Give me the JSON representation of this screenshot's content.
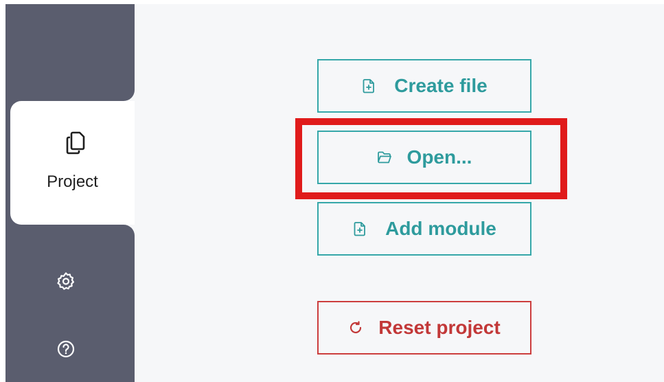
{
  "sidebar": {
    "active_tab": {
      "label": "Project",
      "icon": "copy-files-icon"
    },
    "items": [
      {
        "icon": "gear-icon"
      },
      {
        "icon": "help-circle-icon"
      }
    ]
  },
  "actions": {
    "create_file": {
      "label": "Create file",
      "icon": "file-plus-icon"
    },
    "open": {
      "label": "Open...",
      "icon": "folder-open-icon"
    },
    "add_module": {
      "label": "Add module",
      "icon": "file-plus-icon"
    },
    "reset_project": {
      "label": "Reset project",
      "icon": "refresh-icon"
    }
  },
  "colors": {
    "sidebar_bg": "#5a5d6e",
    "main_bg": "#f6f7f9",
    "accent_teal": "#35a7a9",
    "danger_red": "#cc3d3d",
    "highlight_red": "#e01b1b"
  }
}
